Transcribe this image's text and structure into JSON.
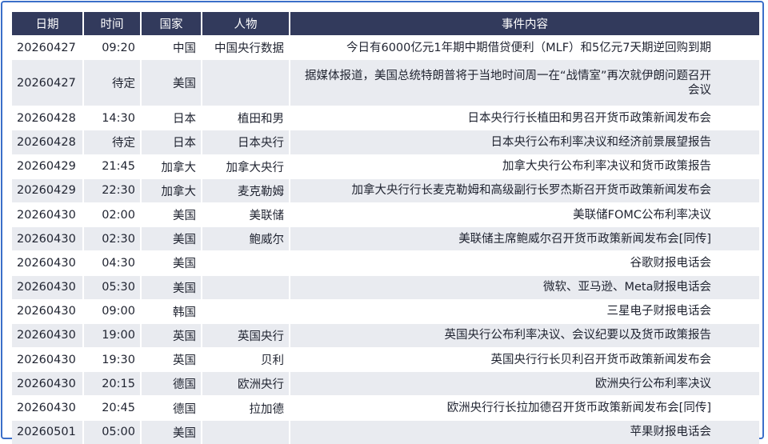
{
  "headers": [
    "日期",
    "时间",
    "国家",
    "人物",
    "事件内容"
  ],
  "rows": [
    {
      "date": "20260427",
      "time": "09:20",
      "country": "中国",
      "person": "中国央行数据",
      "event": "今日有6000亿元1年期中期借贷便利（MLF）和5亿元7天期逆回购到期"
    },
    {
      "date": "20260427",
      "time": "待定",
      "country": "美国",
      "person": "",
      "event": "据媒体报道，美国总统特朗普将于当地时间周一在“战情室”再次就伊朗问题召开会议"
    },
    {
      "date": "20260428",
      "time": "14:30",
      "country": "日本",
      "person": "植田和男",
      "event": "日本央行行长植田和男召开货币政策新闻发布会"
    },
    {
      "date": "20260428",
      "time": "待定",
      "country": "日本",
      "person": "日本央行",
      "event": "日本央行公布利率决议和经济前景展望报告"
    },
    {
      "date": "20260429",
      "time": "21:45",
      "country": "加拿大",
      "person": "加拿大央行",
      "event": "加拿大央行公布利率决议和货币政策报告"
    },
    {
      "date": "20260429",
      "time": "22:30",
      "country": "加拿大",
      "person": "麦克勒姆",
      "event": "加拿大央行行长麦克勒姆和高级副行长罗杰斯召开货币政策新闻发布会"
    },
    {
      "date": "20260430",
      "time": "02:00",
      "country": "美国",
      "person": "美联储",
      "event": "美联储FOMC公布利率决议"
    },
    {
      "date": "20260430",
      "time": "02:30",
      "country": "美国",
      "person": "鲍威尔",
      "event": "美联储主席鲍威尔召开货币政策新闻发布会[同传]"
    },
    {
      "date": "20260430",
      "time": "04:30",
      "country": "美国",
      "person": "",
      "event": "谷歌财报电话会"
    },
    {
      "date": "20260430",
      "time": "05:30",
      "country": "美国",
      "person": "",
      "event": "微软、亚马逊、Meta财报电话会"
    },
    {
      "date": "20260430",
      "time": "09:00",
      "country": "韩国",
      "person": "",
      "event": "三星电子财报电话会"
    },
    {
      "date": "20260430",
      "time": "19:00",
      "country": "英国",
      "person": "英国央行",
      "event": "英国央行公布利率决议、会议纪要以及货币政策报告"
    },
    {
      "date": "20260430",
      "time": "19:30",
      "country": "英国",
      "person": "贝利",
      "event": "英国央行行长贝利召开货币政策新闻发布会"
    },
    {
      "date": "20260430",
      "time": "20:15",
      "country": "德国",
      "person": "欧洲央行",
      "event": "欧洲央行公布利率决议"
    },
    {
      "date": "20260430",
      "time": "20:45",
      "country": "德国",
      "person": "拉加德",
      "event": "欧洲央行行长拉加德召开货币政策新闻发布会[同传]"
    },
    {
      "date": "20260501",
      "time": "05:00",
      "country": "美国",
      "person": "",
      "event": "苹果财报电话会"
    }
  ],
  "colors": {
    "header_bg": "#323a5c",
    "stripe": "#e9ebf0",
    "frame": "#3b6fc9"
  }
}
